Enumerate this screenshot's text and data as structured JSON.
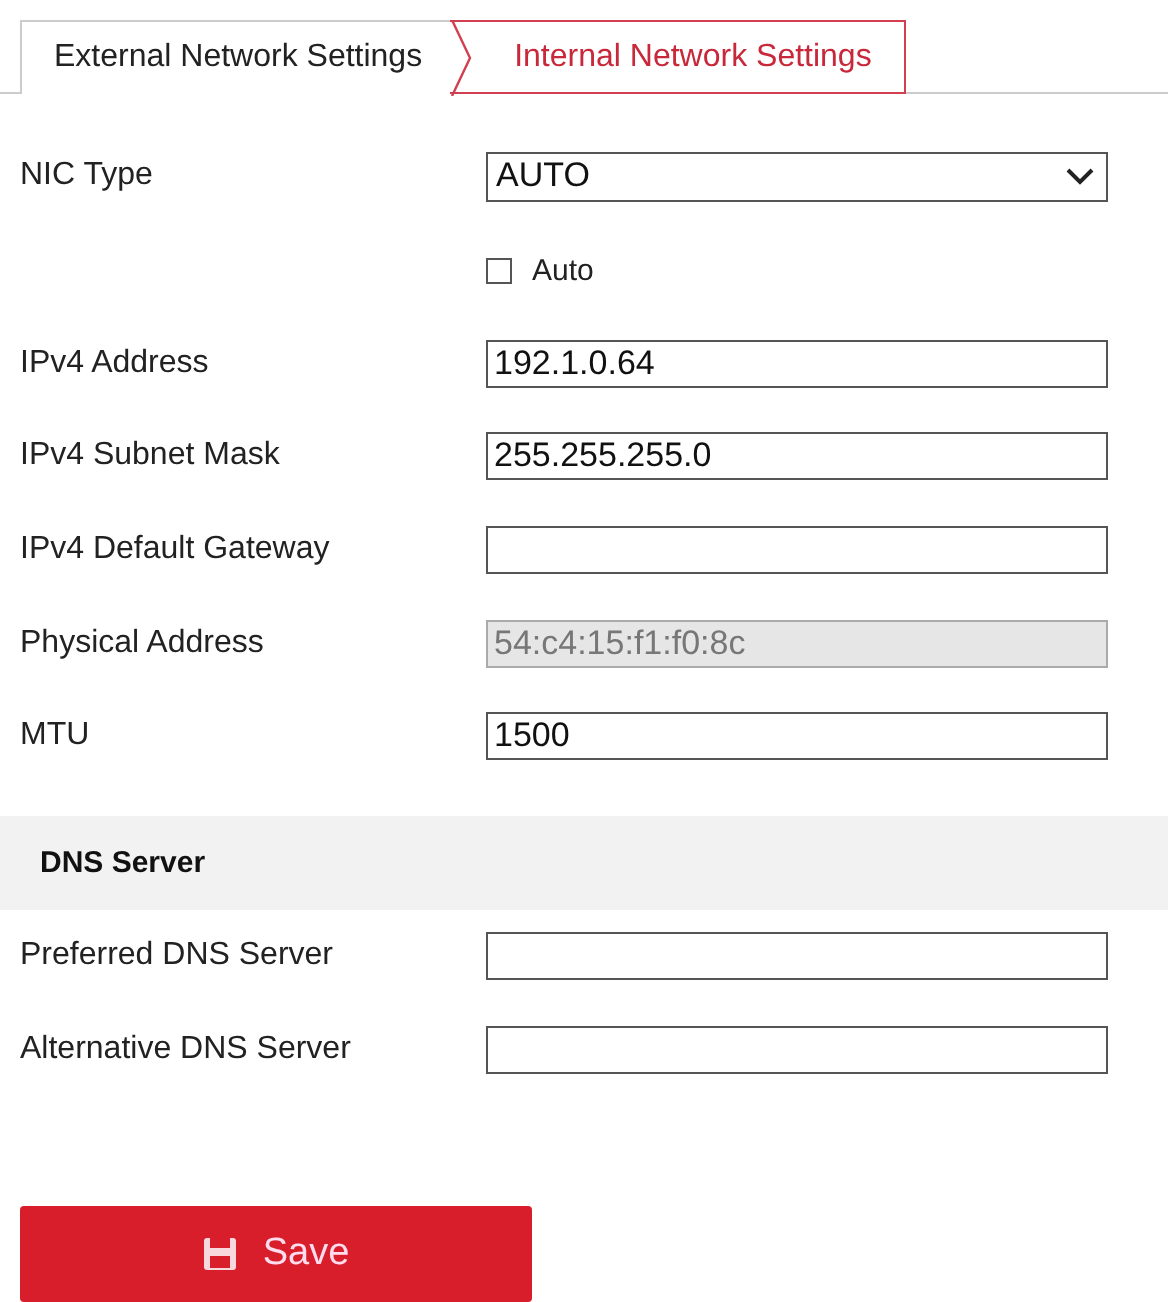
{
  "tabs": [
    {
      "label": "External Network Settings",
      "selected": false
    },
    {
      "label": "Internal Network Settings",
      "selected": true
    }
  ],
  "fields": [
    {
      "kind": "select",
      "label": "NIC Type",
      "value": "AUTO"
    },
    {
      "kind": "checkbox",
      "label": "Auto",
      "checked": false
    },
    {
      "kind": "input",
      "label": "IPv4 Address",
      "value": "192.1.0.64",
      "disabled": false
    },
    {
      "kind": "input",
      "label": "IPv4 Subnet Mask",
      "value": "255.255.255.0",
      "disabled": false
    },
    {
      "kind": "input",
      "label": "IPv4 Default Gateway",
      "disabled": false
    },
    {
      "kind": "input",
      "label": "Physical Address",
      "value": "54:c4:15:f1:f0:8c",
      "disabled": true
    },
    {
      "kind": "input",
      "label": "MTU",
      "value": "1500",
      "disabled": false
    }
  ],
  "dns_section": {
    "title": "DNS Server",
    "fields": [
      {
        "kind": "input",
        "label": "Preferred DNS Server",
        "disabled": false
      },
      {
        "kind": "input",
        "label": "Alternative DNS Server",
        "disabled": false
      }
    ]
  },
  "save_button": {
    "label": "Save"
  }
}
